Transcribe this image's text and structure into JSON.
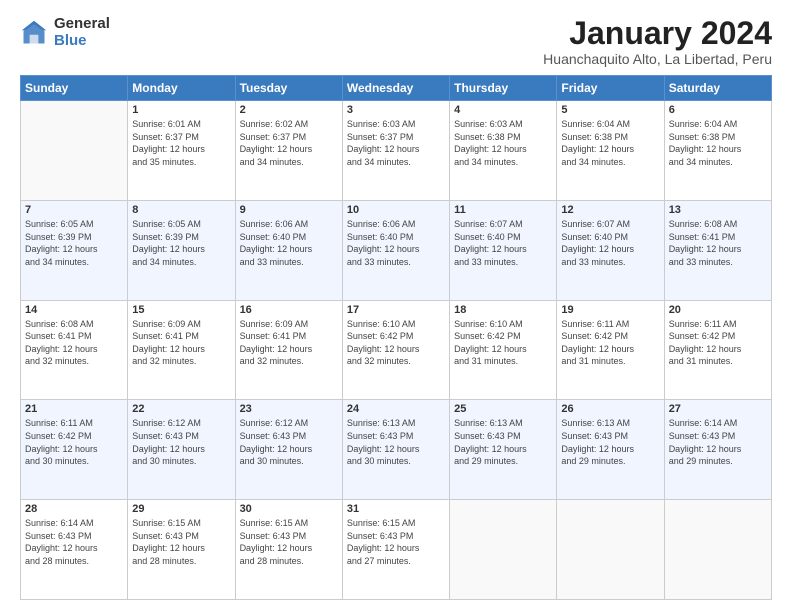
{
  "logo": {
    "general": "General",
    "blue": "Blue"
  },
  "header": {
    "title": "January 2024",
    "subtitle": "Huanchaquito Alto, La Libertad, Peru"
  },
  "weekdays": [
    "Sunday",
    "Monday",
    "Tuesday",
    "Wednesday",
    "Thursday",
    "Friday",
    "Saturday"
  ],
  "weeks": [
    [
      {
        "day": "",
        "info": ""
      },
      {
        "day": "1",
        "info": "Sunrise: 6:01 AM\nSunset: 6:37 PM\nDaylight: 12 hours\nand 35 minutes."
      },
      {
        "day": "2",
        "info": "Sunrise: 6:02 AM\nSunset: 6:37 PM\nDaylight: 12 hours\nand 34 minutes."
      },
      {
        "day": "3",
        "info": "Sunrise: 6:03 AM\nSunset: 6:37 PM\nDaylight: 12 hours\nand 34 minutes."
      },
      {
        "day": "4",
        "info": "Sunrise: 6:03 AM\nSunset: 6:38 PM\nDaylight: 12 hours\nand 34 minutes."
      },
      {
        "day": "5",
        "info": "Sunrise: 6:04 AM\nSunset: 6:38 PM\nDaylight: 12 hours\nand 34 minutes."
      },
      {
        "day": "6",
        "info": "Sunrise: 6:04 AM\nSunset: 6:38 PM\nDaylight: 12 hours\nand 34 minutes."
      }
    ],
    [
      {
        "day": "7",
        "info": "Sunrise: 6:05 AM\nSunset: 6:39 PM\nDaylight: 12 hours\nand 34 minutes."
      },
      {
        "day": "8",
        "info": "Sunrise: 6:05 AM\nSunset: 6:39 PM\nDaylight: 12 hours\nand 34 minutes."
      },
      {
        "day": "9",
        "info": "Sunrise: 6:06 AM\nSunset: 6:40 PM\nDaylight: 12 hours\nand 33 minutes."
      },
      {
        "day": "10",
        "info": "Sunrise: 6:06 AM\nSunset: 6:40 PM\nDaylight: 12 hours\nand 33 minutes."
      },
      {
        "day": "11",
        "info": "Sunrise: 6:07 AM\nSunset: 6:40 PM\nDaylight: 12 hours\nand 33 minutes."
      },
      {
        "day": "12",
        "info": "Sunrise: 6:07 AM\nSunset: 6:40 PM\nDaylight: 12 hours\nand 33 minutes."
      },
      {
        "day": "13",
        "info": "Sunrise: 6:08 AM\nSunset: 6:41 PM\nDaylight: 12 hours\nand 33 minutes."
      }
    ],
    [
      {
        "day": "14",
        "info": "Sunrise: 6:08 AM\nSunset: 6:41 PM\nDaylight: 12 hours\nand 32 minutes."
      },
      {
        "day": "15",
        "info": "Sunrise: 6:09 AM\nSunset: 6:41 PM\nDaylight: 12 hours\nand 32 minutes."
      },
      {
        "day": "16",
        "info": "Sunrise: 6:09 AM\nSunset: 6:41 PM\nDaylight: 12 hours\nand 32 minutes."
      },
      {
        "day": "17",
        "info": "Sunrise: 6:10 AM\nSunset: 6:42 PM\nDaylight: 12 hours\nand 32 minutes."
      },
      {
        "day": "18",
        "info": "Sunrise: 6:10 AM\nSunset: 6:42 PM\nDaylight: 12 hours\nand 31 minutes."
      },
      {
        "day": "19",
        "info": "Sunrise: 6:11 AM\nSunset: 6:42 PM\nDaylight: 12 hours\nand 31 minutes."
      },
      {
        "day": "20",
        "info": "Sunrise: 6:11 AM\nSunset: 6:42 PM\nDaylight: 12 hours\nand 31 minutes."
      }
    ],
    [
      {
        "day": "21",
        "info": "Sunrise: 6:11 AM\nSunset: 6:42 PM\nDaylight: 12 hours\nand 30 minutes."
      },
      {
        "day": "22",
        "info": "Sunrise: 6:12 AM\nSunset: 6:43 PM\nDaylight: 12 hours\nand 30 minutes."
      },
      {
        "day": "23",
        "info": "Sunrise: 6:12 AM\nSunset: 6:43 PM\nDaylight: 12 hours\nand 30 minutes."
      },
      {
        "day": "24",
        "info": "Sunrise: 6:13 AM\nSunset: 6:43 PM\nDaylight: 12 hours\nand 30 minutes."
      },
      {
        "day": "25",
        "info": "Sunrise: 6:13 AM\nSunset: 6:43 PM\nDaylight: 12 hours\nand 29 minutes."
      },
      {
        "day": "26",
        "info": "Sunrise: 6:13 AM\nSunset: 6:43 PM\nDaylight: 12 hours\nand 29 minutes."
      },
      {
        "day": "27",
        "info": "Sunrise: 6:14 AM\nSunset: 6:43 PM\nDaylight: 12 hours\nand 29 minutes."
      }
    ],
    [
      {
        "day": "28",
        "info": "Sunrise: 6:14 AM\nSunset: 6:43 PM\nDaylight: 12 hours\nand 28 minutes."
      },
      {
        "day": "29",
        "info": "Sunrise: 6:15 AM\nSunset: 6:43 PM\nDaylight: 12 hours\nand 28 minutes."
      },
      {
        "day": "30",
        "info": "Sunrise: 6:15 AM\nSunset: 6:43 PM\nDaylight: 12 hours\nand 28 minutes."
      },
      {
        "day": "31",
        "info": "Sunrise: 6:15 AM\nSunset: 6:43 PM\nDaylight: 12 hours\nand 27 minutes."
      },
      {
        "day": "",
        "info": ""
      },
      {
        "day": "",
        "info": ""
      },
      {
        "day": "",
        "info": ""
      }
    ]
  ]
}
